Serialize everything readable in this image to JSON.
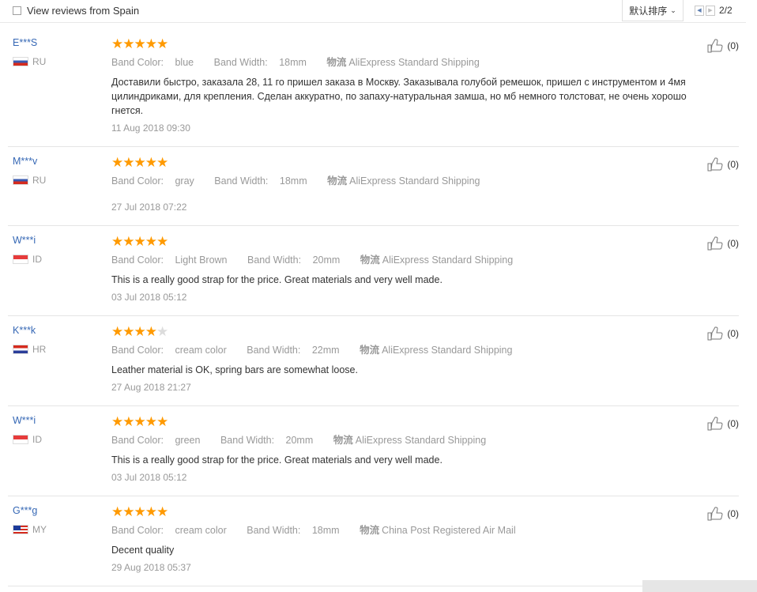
{
  "filter": {
    "spain_label": "View reviews from Spain"
  },
  "sort": {
    "label": "默认排序"
  },
  "pager": {
    "page": "2/2"
  },
  "labels": {
    "band_color_prefix": "Band Color: ",
    "band_width_prefix": "Band Width: ",
    "logistics_label": "物流"
  },
  "reviews": [
    {
      "user": "E***S",
      "country": "RU",
      "flag": "ru",
      "rating": 5,
      "band_color": "blue",
      "band_width": "18mm",
      "shipping": "AliExpress Standard Shipping",
      "text": "Доставили быстро, заказала 28, 11 го пришел заказа в Москву. Заказывала голубой ремешок, пришел с инструментом и 4мя цилиндриками, для крепления. Сделан аккуратно, по запаху-натуральная замша, но мб немного толстоват, не очень хорошо гнется.",
      "date": "11 Aug 2018 09:30",
      "likes": "(0)"
    },
    {
      "user": "M***v",
      "country": "RU",
      "flag": "ru",
      "rating": 5,
      "band_color": "gray",
      "band_width": "18mm",
      "shipping": "AliExpress Standard Shipping",
      "text": "",
      "date": "27 Jul 2018 07:22",
      "likes": "(0)"
    },
    {
      "user": "W***i",
      "country": "ID",
      "flag": "id",
      "rating": 5,
      "band_color": "Light Brown",
      "band_width": "20mm",
      "shipping": "AliExpress Standard Shipping",
      "text": "This is a really good strap for the price. Great materials and very well made.",
      "date": "03 Jul 2018 05:12",
      "likes": "(0)"
    },
    {
      "user": "K***k",
      "country": "HR",
      "flag": "hr",
      "rating": 4,
      "band_color": "cream color",
      "band_width": "22mm",
      "shipping": "AliExpress Standard Shipping",
      "text": "Leather material is OK, spring bars are somewhat loose.",
      "date": "27 Aug 2018 21:27",
      "likes": "(0)"
    },
    {
      "user": "W***i",
      "country": "ID",
      "flag": "id",
      "rating": 5,
      "band_color": "green",
      "band_width": "20mm",
      "shipping": "AliExpress Standard Shipping",
      "text": "This is a really good strap for the price. Great materials and very well made.",
      "date": "03 Jul 2018 05:12",
      "likes": "(0)"
    },
    {
      "user": "G***g",
      "country": "MY",
      "flag": "my",
      "rating": 5,
      "band_color": "cream color",
      "band_width": "18mm",
      "shipping": "China Post Registered Air Mail",
      "text": "Decent quality",
      "date": "29 Aug 2018 05:37",
      "likes": "(0)"
    }
  ]
}
